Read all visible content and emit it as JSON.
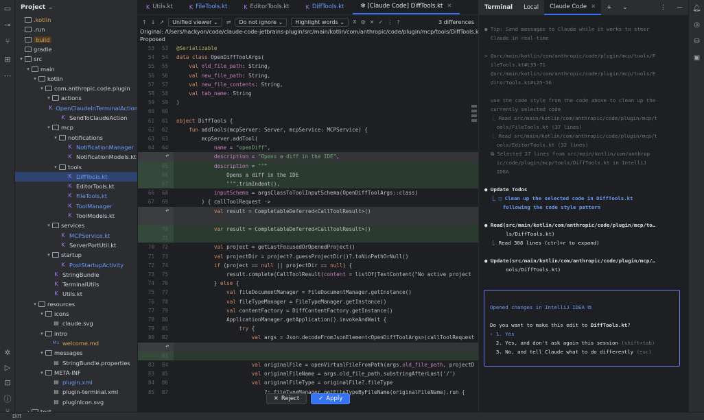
{
  "project_panel": {
    "title": "Project",
    "tree": [
      {
        "label": ".kotlin",
        "depth": 0,
        "icon": "folder",
        "color": "orange",
        "arrow": ""
      },
      {
        "label": ".run",
        "depth": 0,
        "icon": "folder",
        "color": "",
        "arrow": ""
      },
      {
        "label": "build",
        "depth": 0,
        "icon": "folder",
        "color": "orange",
        "arrow": "",
        "highlight": true
      },
      {
        "label": "gradle",
        "depth": 0,
        "icon": "folder",
        "color": "",
        "arrow": ""
      },
      {
        "label": "src",
        "depth": 0,
        "icon": "folder",
        "color": "",
        "arrow": "▾"
      },
      {
        "label": "main",
        "depth": 1,
        "icon": "folder",
        "color": "",
        "arrow": "▾"
      },
      {
        "label": "kotlin",
        "depth": 2,
        "icon": "folder",
        "color": "",
        "arrow": "▾"
      },
      {
        "label": "com.anthropic.code.plugin",
        "depth": 3,
        "icon": "folder",
        "color": "",
        "arrow": "▾"
      },
      {
        "label": "actions",
        "depth": 4,
        "icon": "folder",
        "color": "",
        "arrow": "▾"
      },
      {
        "label": "OpenClaudeInTerminalAction",
        "depth": 5,
        "icon": "kt",
        "color": "blue",
        "arrow": ""
      },
      {
        "label": "SendToClaudeAction",
        "depth": 5,
        "icon": "kt",
        "color": "",
        "arrow": ""
      },
      {
        "label": "mcp",
        "depth": 4,
        "icon": "folder",
        "color": "",
        "arrow": "▾"
      },
      {
        "label": "notifications",
        "depth": 5,
        "icon": "folder",
        "color": "",
        "arrow": "▾"
      },
      {
        "label": "NotificationManager",
        "depth": 6,
        "icon": "kt",
        "color": "blue",
        "arrow": ""
      },
      {
        "label": "NotificationModels.kt",
        "depth": 6,
        "icon": "kt",
        "color": "",
        "arrow": ""
      },
      {
        "label": "tools",
        "depth": 5,
        "icon": "folder",
        "color": "",
        "arrow": "▾"
      },
      {
        "label": "DiffTools.kt",
        "depth": 6,
        "icon": "kt",
        "color": "blue",
        "arrow": "",
        "selected": true
      },
      {
        "label": "EditorTools.kt",
        "depth": 6,
        "icon": "kt",
        "color": "",
        "arrow": ""
      },
      {
        "label": "FileTools.kt",
        "depth": 6,
        "icon": "kt",
        "color": "blue",
        "arrow": ""
      },
      {
        "label": "ToolManager",
        "depth": 6,
        "icon": "kt",
        "color": "blue",
        "arrow": ""
      },
      {
        "label": "ToolModels.kt",
        "depth": 6,
        "icon": "kt",
        "color": "",
        "arrow": ""
      },
      {
        "label": "services",
        "depth": 4,
        "icon": "folder",
        "color": "",
        "arrow": "▾"
      },
      {
        "label": "MCPService.kt",
        "depth": 5,
        "icon": "kt",
        "color": "blue",
        "arrow": ""
      },
      {
        "label": "ServerPortUtil.kt",
        "depth": 5,
        "icon": "kt",
        "color": "",
        "arrow": ""
      },
      {
        "label": "startup",
        "depth": 4,
        "icon": "folder",
        "color": "",
        "arrow": "▾"
      },
      {
        "label": "PostStartupActivity",
        "depth": 5,
        "icon": "kt",
        "color": "blue",
        "arrow": ""
      },
      {
        "label": "StringBundle",
        "depth": 4,
        "icon": "kt",
        "color": "",
        "arrow": ""
      },
      {
        "label": "TerminalUtils",
        "depth": 4,
        "icon": "kt",
        "color": "",
        "arrow": ""
      },
      {
        "label": "Utils.kt",
        "depth": 4,
        "icon": "kt",
        "color": "",
        "arrow": ""
      },
      {
        "label": "resources",
        "depth": 2,
        "icon": "folder",
        "color": "",
        "arrow": "▾"
      },
      {
        "label": "icons",
        "depth": 3,
        "icon": "folder",
        "color": "",
        "arrow": "▾"
      },
      {
        "label": "claude.svg",
        "depth": 4,
        "icon": "file",
        "color": "",
        "arrow": ""
      },
      {
        "label": "intro",
        "depth": 3,
        "icon": "folder",
        "color": "",
        "arrow": "▾"
      },
      {
        "label": "welcome.md",
        "depth": 4,
        "icon": "md",
        "color": "orange",
        "arrow": ""
      },
      {
        "label": "messages",
        "depth": 3,
        "icon": "folder",
        "color": "",
        "arrow": "▾"
      },
      {
        "label": "StringBundle.properties",
        "depth": 4,
        "icon": "file",
        "color": "",
        "arrow": ""
      },
      {
        "label": "META-INF",
        "depth": 3,
        "icon": "folder",
        "color": "",
        "arrow": "▾"
      },
      {
        "label": "plugin.xml",
        "depth": 4,
        "icon": "file",
        "color": "blue",
        "arrow": ""
      },
      {
        "label": "plugin-terminal.xml",
        "depth": 4,
        "icon": "file",
        "color": "",
        "arrow": ""
      },
      {
        "label": "pluginIcon.svg",
        "depth": 4,
        "icon": "file",
        "color": "",
        "arrow": ""
      },
      {
        "label": "test",
        "depth": 1,
        "icon": "folder",
        "color": "",
        "arrow": "›"
      }
    ]
  },
  "editor": {
    "tabs": [
      {
        "label": "Utils.kt",
        "blue": false,
        "active": false
      },
      {
        "label": "FileTools.kt",
        "blue": true,
        "active": false
      },
      {
        "label": "EditorTools.kt",
        "blue": false,
        "active": false
      },
      {
        "label": "DiffTools.kt",
        "blue": true,
        "active": false
      },
      {
        "label": "✻ [Claude Code] DiffTools.kt",
        "blue": false,
        "active": true
      }
    ],
    "toolbar": {
      "viewer": "Unified viewer",
      "ignore": "Do not ignore",
      "highlight": "Highlight words",
      "differences": "3 differences"
    },
    "original_path": "Original: /Users/hackyon/code/claude-code-jetbrains-plugin/src/main/kotlin/com/anthropic/code/plugin/mcp/tools/DiffTools.kt",
    "proposed_label": "Proposed",
    "reject_label": "Reject",
    "apply_label": "Apply"
  },
  "code_lines": [
    {
      "l": "53",
      "r": "53",
      "t": "@Serializable",
      "k": "ann"
    },
    {
      "l": "54",
      "r": "54",
      "t": "data class OpenDiffToolArgs(",
      "k": ""
    },
    {
      "l": "55",
      "r": "55",
      "t": "    val old_file_path: String,",
      "k": ""
    },
    {
      "l": "56",
      "r": "56",
      "t": "    val new_file_path: String,",
      "k": ""
    },
    {
      "l": "57",
      "r": "57",
      "t": "    val new_file_contents: String,",
      "k": ""
    },
    {
      "l": "58",
      "r": "58",
      "t": "    val tab_name: String",
      "k": ""
    },
    {
      "l": "59",
      "r": "59",
      "t": ")",
      "k": ""
    },
    {
      "l": "60",
      "r": "60",
      "t": "",
      "k": ""
    },
    {
      "l": "61",
      "r": "61",
      "t": "object DiffTools {",
      "k": ""
    },
    {
      "l": "62",
      "r": "62",
      "t": "    fun addTools(mcpServer: Server, mcpService: MCPService) {",
      "k": ""
    },
    {
      "l": "63",
      "r": "63",
      "t": "        mcpServer.addTool(",
      "k": ""
    },
    {
      "l": "64",
      "r": "64",
      "t": "            name = \"openDiff\",",
      "k": ""
    },
    {
      "l": "",
      "r": "",
      "t": "            description = \"Opens a diff in the IDE\",",
      "k": "del",
      "revert": true
    },
    {
      "l": "",
      "r": "65",
      "t": "            description = \"\"\"",
      "k": "add"
    },
    {
      "l": "",
      "r": "66",
      "t": "                Opens a diff in the IDE",
      "k": "add"
    },
    {
      "l": "",
      "r": "67",
      "t": "                \"\"\".trimIndent(),",
      "k": "add"
    },
    {
      "l": "66",
      "r": "68",
      "t": "            inputSchema = argsClassToToolInputSchema(OpenDiffToolArgs::class)",
      "k": ""
    },
    {
      "l": "67",
      "r": "69",
      "t": "        ) { callToolRequest ->",
      "k": ""
    },
    {
      "l": "",
      "r": "",
      "t": "            val result = CompletableDeferred<CallToolResult>()",
      "k": "del",
      "revert": true
    },
    {
      "l": "",
      "r": "",
      "t": "",
      "k": "del"
    },
    {
      "l": "",
      "r": "70",
      "t": "            var result = CompletableDeferred<CallToolResult>()",
      "k": "add"
    },
    {
      "l": "",
      "r": "71",
      "t": "",
      "k": "add"
    },
    {
      "l": "70",
      "r": "72",
      "t": "            val project = getLastFocusedOrOpenedProject()",
      "k": ""
    },
    {
      "l": "71",
      "r": "73",
      "t": "            val projectDir = project?.guessProjectDir()?.toNioPathOrNull()",
      "k": ""
    },
    {
      "l": "72",
      "r": "74",
      "t": "            if (project == null || projectDir == null) {",
      "k": ""
    },
    {
      "l": "73",
      "r": "75",
      "t": "                result.complete(CallToolResult(content = listOf(TextContent(\"No active project",
      "k": ""
    },
    {
      "l": "74",
      "r": "76",
      "t": "            } else {",
      "k": ""
    },
    {
      "l": "75",
      "r": "77",
      "t": "                val fileDocumentManager = FileDocumentManager.getInstance()",
      "k": ""
    },
    {
      "l": "76",
      "r": "78",
      "t": "                val fileTypeManager = FileTypeManager.getInstance()",
      "k": ""
    },
    {
      "l": "77",
      "r": "79",
      "t": "                val contentFactory = DiffContentFactory.getInstance()",
      "k": ""
    },
    {
      "l": "78",
      "r": "80",
      "t": "                ApplicationManager.getApplication().invokeAndWait {",
      "k": ""
    },
    {
      "l": "79",
      "r": "81",
      "t": "                    try {",
      "k": ""
    },
    {
      "l": "80",
      "r": "82",
      "t": "                        val args = Json.decodeFromJsonElement<OpenDiffToolArgs>(callToolRequest",
      "k": ""
    },
    {
      "l": "",
      "r": "",
      "t": "",
      "k": "del",
      "revert": true
    },
    {
      "l": "",
      "r": "83",
      "t": "",
      "k": "add"
    },
    {
      "l": "82",
      "r": "84",
      "t": "                        val originalFile = openVirtualFileFromPath(args.old_file_path, projectD",
      "k": ""
    },
    {
      "l": "83",
      "r": "85",
      "t": "                        val originalFileName = args.old_file_path.substringAfterLast('/')",
      "k": ""
    },
    {
      "l": "84",
      "r": "86",
      "t": "                        val originalFileType = originalFile?.fileType",
      "k": ""
    },
    {
      "l": "85",
      "r": "87",
      "t": "                            ?: fileTypeManager.getFileTypeByFileName(originalFileName).run {",
      "k": ""
    }
  ],
  "terminal": {
    "tabs": [
      "Terminal",
      "Local",
      "Claude Code"
    ],
    "lines": [
      {
        "t": "● Tip: Send messages to Claude while it works to steer",
        "c": "dim"
      },
      {
        "t": "  Claude in real-time",
        "c": "dim"
      },
      {
        "t": "",
        "c": ""
      },
      {
        "t": "> @src/main/kotlin/com/anthropic/code/plugin/mcp/tools/F",
        "c": "dim"
      },
      {
        "t": "  ileTools.kt#L35-71",
        "c": "dim"
      },
      {
        "t": "  @src/main/kotlin/com/anthropic/code/plugin/mcp/tools/E",
        "c": "dim"
      },
      {
        "t": "  ditorTools.kt#L25-56",
        "c": "dim"
      },
      {
        "t": "",
        "c": ""
      },
      {
        "t": "  use the code style from the code above to clean up the",
        "c": "dim"
      },
      {
        "t": "  currently selected code",
        "c": "dim"
      },
      {
        "t": "  ⎿ Read src/main/kotlin/com/anthropic/code/plugin/mcp/t",
        "c": "dim"
      },
      {
        "t": "    ools/FileTools.kt (37 lines)",
        "c": "dim"
      },
      {
        "t": "  ⎿ Read src/main/kotlin/com/anthropic/code/plugin/mcp/t",
        "c": "dim"
      },
      {
        "t": "    ools/EditorTools.kt (32 lines)",
        "c": "dim"
      },
      {
        "t": "  ⧉ Selected 27 lines from src/main/kotlin/com/anthrop",
        "c": "dim"
      },
      {
        "t": "    ic/code/plugin/mcp/tools/DiffTools.kt in IntelliJ",
        "c": "dim"
      },
      {
        "t": "    IDEA",
        "c": "dim"
      },
      {
        "t": "",
        "c": ""
      },
      {
        "t": "● Update Todos",
        "c": "whtb"
      },
      {
        "t": "  ⎿ □ Clean up the selected code in DiffTools.kt",
        "c": "blub"
      },
      {
        "t": "      following the code style pattern",
        "c": "blub"
      },
      {
        "t": "",
        "c": ""
      },
      {
        "t": "● Read(src/main/kotlin/com/anthropic/code/plugin/mcp/to…",
        "c": "whtb"
      },
      {
        "t": "       ls/DiffTools.kt)",
        "c": "wht"
      },
      {
        "t": "  ⎿ Read 308 lines (ctrl+r to expand)",
        "c": "wht"
      },
      {
        "t": "",
        "c": ""
      },
      {
        "t": "● Update(src/main/kotlin/com/anthropic/code/plugin/mcp/…",
        "c": "whtb"
      },
      {
        "t": "       ools/DiffTools.kt)",
        "c": "wht"
      }
    ],
    "dialog": {
      "title": "Opened changes in IntelliJ IDEA ⧉",
      "question_pre": "Do you want to make this edit to ",
      "question_file": "DiffTools.kt",
      "question_post": "?",
      "opt1": "› 1. Yes",
      "opt2": "  2. Yes, and don't ask again this session",
      "opt2_hint": " (shift+tab)",
      "opt3": "  3. No, and tell Claude what to do differently",
      "opt3_hint": " (esc)"
    }
  },
  "status_bar": {
    "text": "Diff"
  },
  "colors": {
    "accent": "#3574f0",
    "added_bg": "#2b3a2e",
    "deleted_bg": "#333538"
  }
}
